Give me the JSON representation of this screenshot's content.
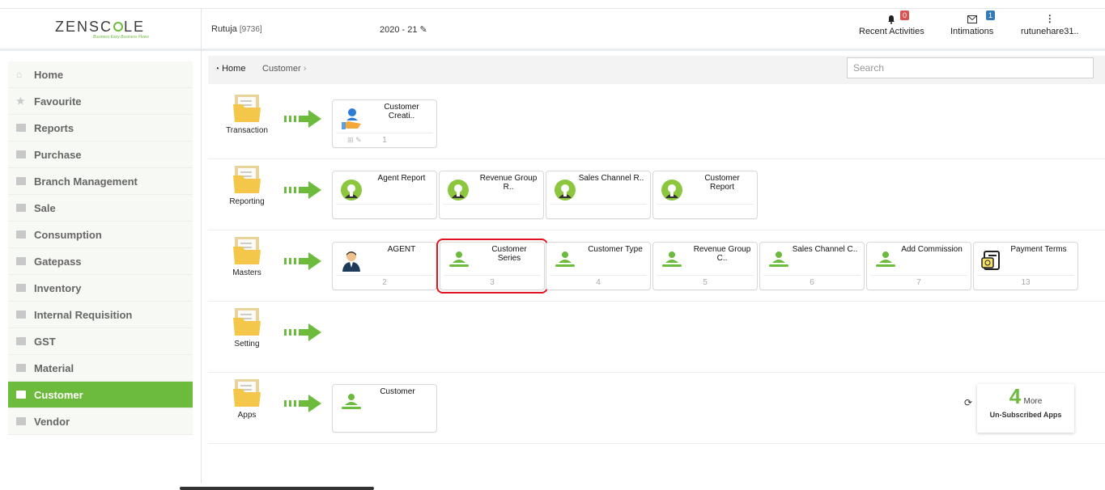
{
  "header": {
    "logo_text": "ZENSCALE",
    "tagline": "Business Easy Business Flows",
    "user_name": "Rutuja",
    "user_id": "[9736]",
    "year": "2020 - 21",
    "recent_activities_label": "Recent Activities",
    "recent_activities_count": "0",
    "intimations_label": "Intimations",
    "intimations_count": "1",
    "account_label": "rutunehare31.."
  },
  "sidebar": {
    "items": [
      {
        "label": "Home",
        "icon": "home-icon"
      },
      {
        "label": "Favourite",
        "icon": "star-icon"
      },
      {
        "label": "Reports",
        "icon": "file-icon"
      },
      {
        "label": "Purchase",
        "icon": "folder-icon"
      },
      {
        "label": "Branch Management",
        "icon": "folder-icon"
      },
      {
        "label": "Sale",
        "icon": "folder-icon"
      },
      {
        "label": "Consumption",
        "icon": "folder-icon"
      },
      {
        "label": "Gatepass",
        "icon": "folder-icon"
      },
      {
        "label": "Inventory",
        "icon": "folder-icon"
      },
      {
        "label": "Internal Requisition",
        "icon": "folder-icon"
      },
      {
        "label": "GST",
        "icon": "folder-icon"
      },
      {
        "label": "Material",
        "icon": "folder-icon"
      },
      {
        "label": "Customer",
        "icon": "folder-icon",
        "active": true
      },
      {
        "label": "Vendor",
        "icon": "folder-icon"
      }
    ]
  },
  "breadcrumb": {
    "home": "Home",
    "current": "Customer"
  },
  "search": {
    "placeholder": "Search"
  },
  "sections": {
    "transaction": {
      "label": "Transaction",
      "tiles": [
        {
          "title": "Customer Creati..",
          "count": "1"
        }
      ]
    },
    "reporting": {
      "label": "Reporting",
      "tiles": [
        {
          "title": "Agent Report",
          "count": ""
        },
        {
          "title": "Revenue Group R..",
          "count": ""
        },
        {
          "title": "Sales Channel R..",
          "count": ""
        },
        {
          "title": "Customer Report",
          "count": ""
        }
      ]
    },
    "masters": {
      "label": "Masters",
      "tiles": [
        {
          "title": "AGENT",
          "count": "2"
        },
        {
          "title": "Customer Series",
          "count": "3"
        },
        {
          "title": "Customer Type",
          "count": "4"
        },
        {
          "title": "Revenue Group C..",
          "count": "5"
        },
        {
          "title": "Sales Channel C..",
          "count": "6"
        },
        {
          "title": "Add Commission",
          "count": "7"
        },
        {
          "title": "Payment Terms",
          "count": "13"
        }
      ]
    },
    "setting": {
      "label": "Setting",
      "tiles": []
    },
    "apps": {
      "label": "Apps",
      "tiles": [
        {
          "title": "Customer",
          "count": ""
        }
      ]
    }
  },
  "more_apps": {
    "count": "4",
    "more_label": "More",
    "subtitle": "Un-Subscribed Apps"
  },
  "colors": {
    "accent": "#6cbb3c",
    "highlight": "#e0141e"
  }
}
